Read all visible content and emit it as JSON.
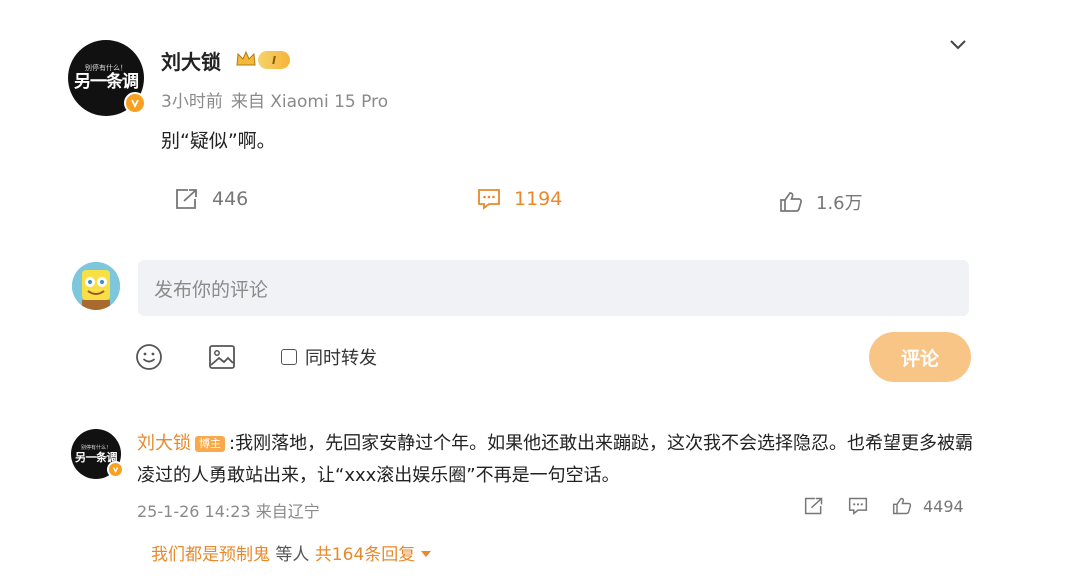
{
  "post": {
    "author": "刘大锁",
    "avatar_text_small": "别停有什么！",
    "avatar_text_big": "另一条调",
    "level_badge": "I",
    "time": "3小时前",
    "source": "来自 Xiaomi 15 Pro",
    "text": "别“疑似”啊。",
    "forward_count": "446",
    "comment_count": "1194",
    "like_count": "1.6万"
  },
  "composer": {
    "placeholder": "发布你的评论",
    "repost_label": "同时转发",
    "submit_label": "评论"
  },
  "comment": {
    "author": "刘大锁",
    "badge": "博主",
    "text": ":我刚落地，先回家安静过个年。如果他还敢出来蹦跶，这次我不会选择隐忍。也希望更多被霸凌过的人勇敢站出来，让“xxx滚出娱乐圈”不再是一句空话。",
    "date": "25-1-26 14:23",
    "source": "来自辽宁",
    "like_count": "4494",
    "replies_users": "我们都是预制鬼",
    "replies_etc": "等人",
    "replies_total": "共164条回复"
  },
  "colors": {
    "accent": "#e8892d",
    "submit_bg": "#f8c586",
    "input_bg": "#f1f2f5"
  },
  "icons": [
    "chevron-down-icon",
    "crown-icon",
    "forward-icon",
    "comment-icon",
    "like-icon",
    "emoji-icon",
    "image-icon",
    "verified-icon"
  ]
}
